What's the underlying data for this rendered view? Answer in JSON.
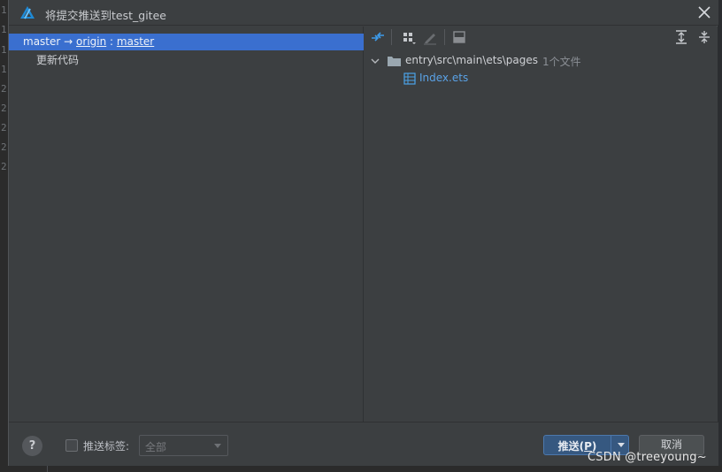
{
  "background_gutter": {
    "line_numbers": [
      "1",
      "1",
      "1",
      "1",
      "2",
      "2",
      "2",
      "2",
      "2"
    ]
  },
  "dialog": {
    "title": "将提交推送到test_gitee",
    "left_pane": {
      "branch": {
        "local": "master",
        "arrow": "→",
        "remote": "origin",
        "separator": ":",
        "remote_branch": "master"
      },
      "commits": [
        "更新代码"
      ]
    },
    "toolbar": {
      "icons": [
        "diff-icon",
        "group-by-icon",
        "edit-icon",
        "preview-icon",
        "expand-all-icon",
        "collapse-all-icon"
      ]
    },
    "tree": {
      "folder_path": "entry\\src\\main\\ets\\pages",
      "file_count": "1个文件",
      "files": [
        "Index.ets"
      ]
    },
    "footer": {
      "help": "?",
      "push_tags_label": "推送标签:",
      "tags_select_value": "全部",
      "push_label_prefix": "推送(",
      "push_label_mnemonic": "P",
      "push_label_suffix": ")",
      "cancel_label": "取消"
    }
  },
  "watermark": "CSDN @treeyoung~",
  "colors": {
    "selection": "#3a6fcf",
    "file_link": "#5aa2e6",
    "primary_button": "#365880"
  }
}
